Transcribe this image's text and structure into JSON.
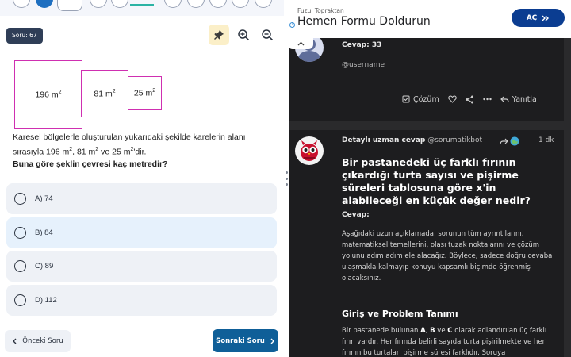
{
  "left": {
    "question_badge": "Soru: 67",
    "figure": {
      "squares": [
        {
          "value": "196 m",
          "exp": "2"
        },
        {
          "value": "81 m",
          "exp": "2"
        },
        {
          "value": "25 m",
          "exp": "2"
        }
      ]
    },
    "question": {
      "line1": "Karesel bölgelerle oluşturulan yukarıdaki şekilde karelerin alanı",
      "line2_a": "sırasıyla 196 m",
      "line2_b": ", 81 m",
      "line2_c": " ve 25 m",
      "line2_d": "'dir.",
      "exp": "2",
      "prompt": "Buna göre şeklin çevresi kaç metredir?"
    },
    "options": [
      {
        "label": "A) 74",
        "selected": false
      },
      {
        "label": "B) 84",
        "selected": true
      },
      {
        "label": "C) 89",
        "selected": false
      },
      {
        "label": "D) 112",
        "selected": false
      }
    ],
    "prev_label": "Önceki Soru",
    "next_label": "Sonraki Soru"
  },
  "ad": {
    "advertiser": "Fuzul Topraktan",
    "headline": "Hemen Formu Doldurun",
    "cta": "AÇ"
  },
  "right": {
    "card1": {
      "answer": "Cevap: 33",
      "username": "@username",
      "solution_label": "Çözüm",
      "reply_label": "Yanıtla"
    },
    "card2": {
      "header_title": "Detaylı uzman cevap",
      "header_user": "@sorumatikbot",
      "time": "1 dk",
      "title": "Bir pastanedeki üç farklı fırının çıkardığı turta sayısı ve pişirme süreleri tablosuna göre x'in alabileceği en küçük değer nedir?",
      "cevap": "Cevap:",
      "body": "Aşağıdaki uzun açıklamada, sorunun tüm ayrıntılarını, matematiksel temellerini, olası tuzak noktalarını ve çözüm yolunu adım adım ele alacağız. Böylece, sadece doğru cevaba ulaşmakla kalmayıp konuyu kapsamlı biçimde öğrenmiş olacaksınız.",
      "section_title": "Giriş ve Problem Tanımı",
      "body2_a": "Bir pastanede bulunan ",
      "body2_b": "A",
      "body2_c": ", ",
      "body2_d": "B",
      "body2_e": " ve ",
      "body2_f": "C",
      "body2_g": " olarak adlandırılan üç farklı fırın vardır. Her fırında belirli sayıda turta pişirilmekte ve her fırının bu turtaları pişirme süresi farklıdır. Soruya"
    }
  },
  "colors": {
    "brand_blue": "#0f5f98",
    "square_border": "#cf2fb1",
    "ad_button": "#0b3d91",
    "dark_card": "#1d1d1f"
  }
}
